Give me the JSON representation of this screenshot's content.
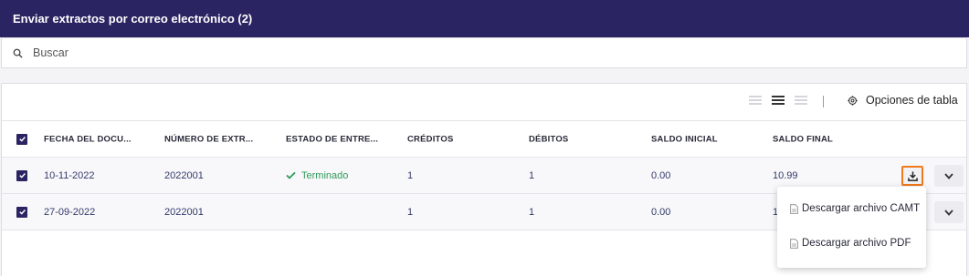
{
  "header": {
    "title": "Enviar extractos por correo electrónico (2)"
  },
  "search": {
    "placeholder": "Buscar"
  },
  "toolbar": {
    "table_options_label": "Opciones de tabla"
  },
  "table": {
    "columns": [
      "FECHA DEL DOCU...",
      "NÚMERO DE EXTR...",
      "ESTADO DE ENTRE...",
      "CRÉDITOS",
      "DÉBITOS",
      "SALDO INICIAL",
      "SALDO FINAL"
    ],
    "rows": [
      {
        "fecha": "10-11-2022",
        "numero": "2022001",
        "estado": "Terminado",
        "creditos": "1",
        "debitos": "1",
        "saldo_inicial": "0.00",
        "saldo_final": "10.99"
      },
      {
        "fecha": "27-09-2022",
        "numero": "2022001",
        "estado": "",
        "creditos": "1",
        "debitos": "1",
        "saldo_inicial": "0.00",
        "saldo_final": "10"
      }
    ]
  },
  "download_menu": {
    "items": [
      "Descargar archivo CAMT",
      "Descargar archivo PDF"
    ]
  },
  "colors": {
    "header_bg": "#2b2462",
    "success": "#2e9a5a",
    "highlight": "#f07a1a"
  }
}
